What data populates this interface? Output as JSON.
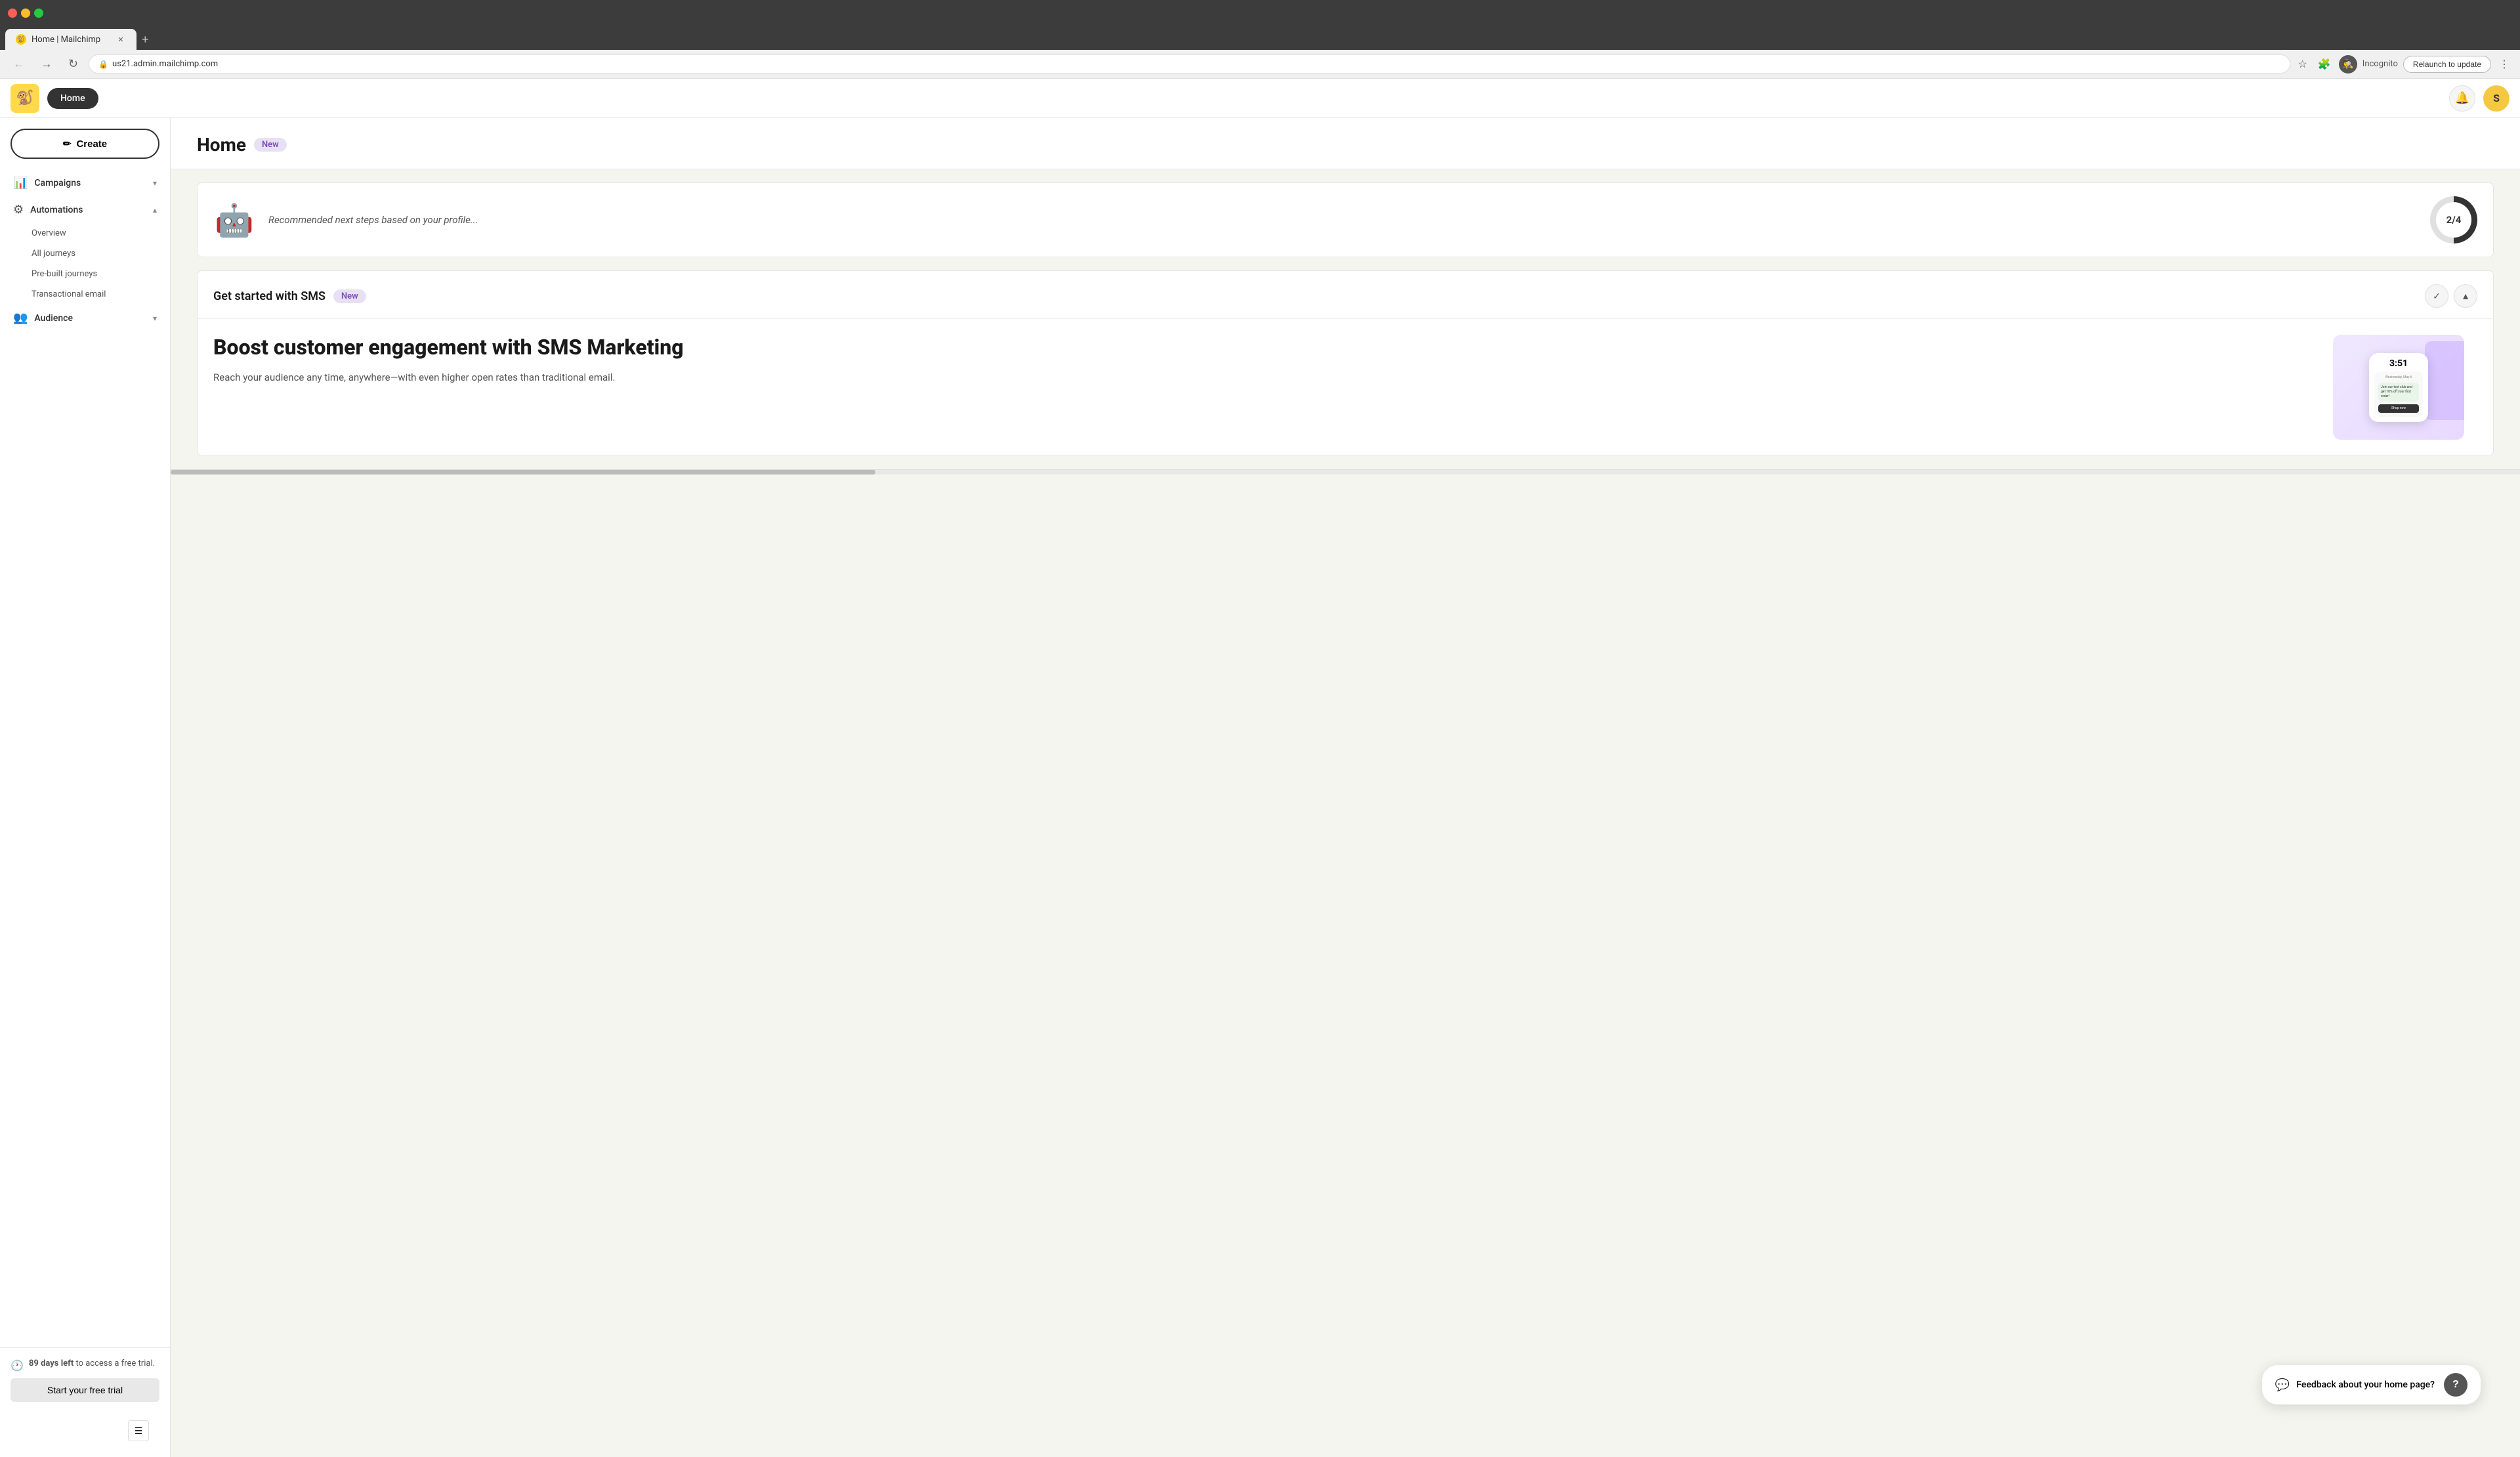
{
  "browser": {
    "tab_title": "Home | Mailchimp",
    "tab_favicon": "🐒",
    "new_tab_icon": "+",
    "url": "us21.admin.mailchimp.com",
    "relaunch_label": "Relaunch to update",
    "incognito_label": "Incognito",
    "user_initial": "S",
    "nav_back": "←",
    "nav_forward": "→",
    "nav_refresh": "↻",
    "lock_icon": "🔒"
  },
  "topbar": {
    "logo_emoji": "🐒",
    "home_label": "Home",
    "notification_icon": "🔔",
    "user_initial": "S"
  },
  "sidebar": {
    "create_label": "Create",
    "create_icon": "✏",
    "items": [
      {
        "id": "campaigns",
        "label": "Campaigns",
        "icon": "📊",
        "chevron": "▾",
        "expanded": false
      },
      {
        "id": "automations",
        "label": "Automations",
        "icon": "⚙",
        "chevron": "▴",
        "expanded": true
      }
    ],
    "sub_items": [
      {
        "id": "overview",
        "label": "Overview"
      },
      {
        "id": "all-journeys",
        "label": "All journeys"
      },
      {
        "id": "pre-built",
        "label": "Pre-built journeys"
      },
      {
        "id": "transactional",
        "label": "Transactional email"
      }
    ],
    "audience_item": {
      "label": "Audience",
      "icon": "👥",
      "chevron": "▾"
    },
    "trial_icon": "🕐",
    "trial_days": "89 days left",
    "trial_text": " to access a free trial.",
    "start_trial_label": "Start your free trial",
    "collapse_icon": "☰"
  },
  "main": {
    "page_title": "Home",
    "new_badge": "New",
    "progress_text": "Recommended next steps based on your profile...",
    "progress_ratio": "2/4",
    "sms_title": "Get started with SMS",
    "sms_badge": "New",
    "sms_headline": "Boost customer engagement with SMS Marketing",
    "sms_subtext": "Reach your audience any time, anywhere—with even higher open rates than traditional email.",
    "phone_time": "3:51",
    "phone_date": "Wednesday, May 6",
    "phone_msg": "Join our text club and get 10% off your first order!",
    "phone_cta": "Shop now",
    "check_icon": "✓",
    "chevron_up": "▲",
    "feedback_label": "Feedback about your home page?",
    "feedback_icon": "💬",
    "help_label": "?"
  }
}
